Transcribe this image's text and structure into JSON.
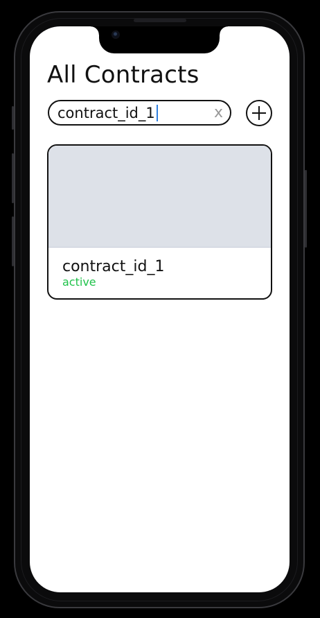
{
  "header": {
    "title": "All Contracts"
  },
  "search": {
    "value": "contract_id_1",
    "clear_label": "x"
  },
  "add_button": {
    "icon": "plus-icon"
  },
  "contracts": [
    {
      "title": "contract_id_1",
      "status": "active",
      "status_color": "#1fc24a",
      "image_placeholder_color": "#dde1e8"
    }
  ],
  "colors": {
    "background": "#ffffff",
    "device_frame": "#0b0b0c",
    "text": "#111111",
    "caret": "#2f7fe0",
    "clear_button": "#999999"
  }
}
